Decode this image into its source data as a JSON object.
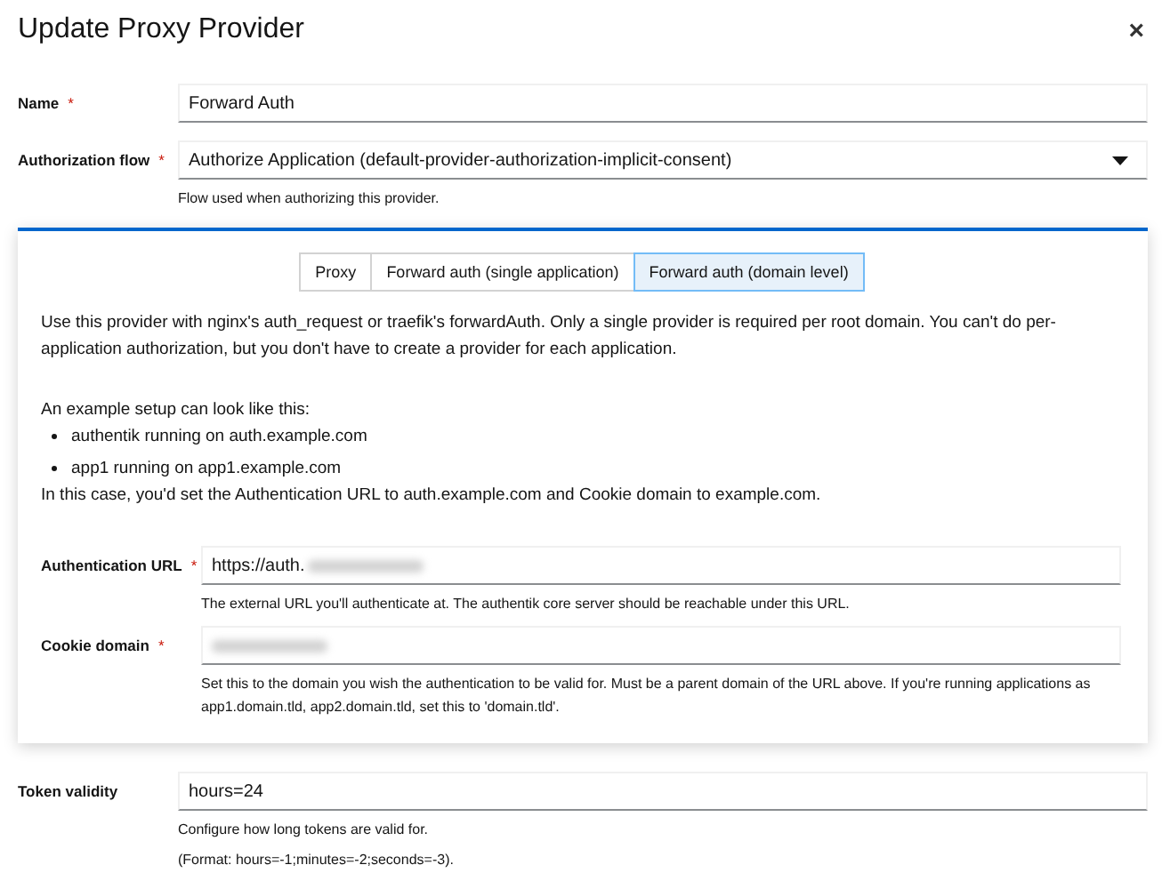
{
  "dialog": {
    "title": "Update Proxy Provider",
    "close": "×"
  },
  "fields": [
    {
      "label": "Name",
      "required_mark": "*",
      "kind": "text",
      "value": "Forward Auth"
    },
    {
      "label": "Authorization flow",
      "required_mark": "*",
      "kind": "select",
      "value": "Authorize Application (default-provider-authorization-implicit-consent)",
      "help": [
        "Flow used when authorizing this provider."
      ]
    }
  ],
  "mode_card": {
    "tabs": [
      {
        "label": "Proxy",
        "selected": false
      },
      {
        "label": "Forward auth (single application)",
        "selected": false
      },
      {
        "label": "Forward auth (domain level)",
        "selected": true
      }
    ],
    "description": "Use this provider with nginx's auth_request or traefik's forwardAuth. Only a single provider is required per root domain. You can't do per-application authorization, but you don't have to create a provider for each application.",
    "example_intro": "An example setup can look like this:",
    "example_items": [
      "authentik running on auth.example.com",
      "app1 running on app1.example.com"
    ],
    "example_outro": "In this case, you'd set the Authentication URL to auth.example.com and Cookie domain to example.com.",
    "fields": [
      {
        "label": "Authentication URL",
        "required_mark": "*",
        "value": "https://auth.",
        "redacted": true,
        "help": [
          "The external URL you'll authenticate at. The authentik core server should be reachable under this URL."
        ]
      },
      {
        "label": "Cookie domain",
        "required_mark": "*",
        "redacted": true,
        "help": [
          "Set this to the domain you wish the authentication to be valid for. Must be a parent domain of the URL above. If you're running applications as app1.domain.tld, app2.domain.tld, set this to 'domain.tld'."
        ]
      }
    ]
  },
  "after_fields": [
    {
      "label": "Token validity",
      "value": "hours=24",
      "help": [
        "Configure how long tokens are valid for.",
        "(Format: hours=-1;minutes=-2;seconds=-3)."
      ]
    }
  ]
}
